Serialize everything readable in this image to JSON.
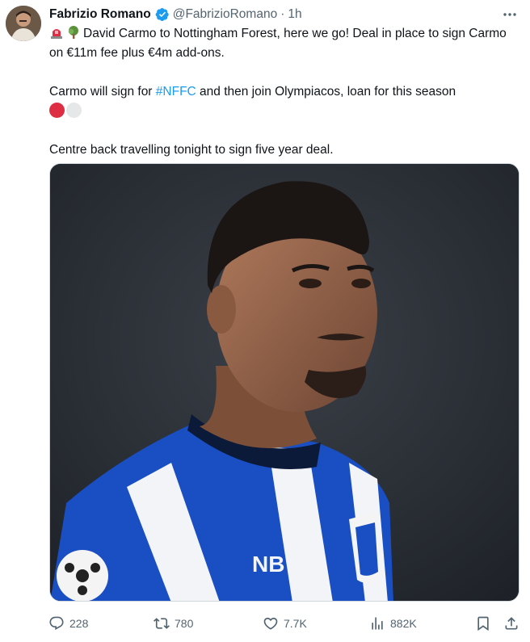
{
  "author": {
    "name": "Fabrizio Romano",
    "handle": "@FabrizioRomano",
    "separator": "·",
    "time": "1h"
  },
  "tweet": {
    "line1_text": "David Carmo to Nottingham Forest, here we go! Deal in place to sign Carmo on €11m fee plus €4m add-ons.",
    "line2_prefix": "Carmo will sign for ",
    "line2_hashtag": "#NFFC",
    "line2_suffix": " and then join Olympiacos, loan for this season",
    "line3_text": "Centre back travelling tonight to sign five year deal."
  },
  "icons": {
    "siren": "siren-emoji-icon",
    "tree": "tree-emoji-icon",
    "red_circle": "red-circle-emoji-icon",
    "white_circle": "white-circle-emoji-icon",
    "verified": "verified-badge-icon",
    "more": "more-horizontal-icon",
    "reply": "reply-icon",
    "retweet": "retweet-icon",
    "like": "heart-icon",
    "views": "views-bar-chart-icon",
    "bookmark": "bookmark-icon",
    "share": "share-icon"
  },
  "actions": {
    "replies": "228",
    "retweets": "780",
    "likes": "7.7K",
    "views": "882K"
  },
  "colors": {
    "accent": "#1d9bf0",
    "text_primary": "#0f1419",
    "text_secondary": "#536471",
    "emoji_red": "#dd2e44",
    "emoji_white": "#e6e7e8"
  }
}
